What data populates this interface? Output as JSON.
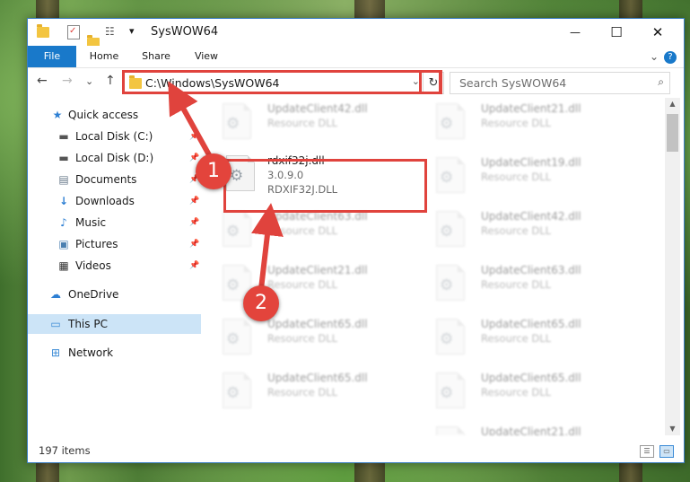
{
  "window": {
    "title": "SysWOW64",
    "controls": {
      "minimize": "—",
      "maximize": "☐",
      "close": "✕"
    }
  },
  "quick_access_toolbar": {
    "dropdown": "▾"
  },
  "ribbon": {
    "tabs": [
      "File",
      "Home",
      "Share",
      "View"
    ],
    "collapse": "⌄",
    "help": "?"
  },
  "navigation": {
    "back": "←",
    "forward": "→",
    "recent": "⌄",
    "up": "↑",
    "address": "C:\\Windows\\SysWOW64",
    "address_dropdown": "⌄",
    "refresh": "↻",
    "search_placeholder": "Search SysWOW64"
  },
  "sidebar": {
    "items": [
      {
        "label": "Quick access",
        "icon": "star-icon",
        "glyph": "★",
        "color": "#2d7fd3",
        "pinned": false
      },
      {
        "label": "Local Disk (C:)",
        "icon": "drive-icon",
        "glyph": "▬",
        "color": "#555555",
        "pinned": true
      },
      {
        "label": "Local Disk (D:)",
        "icon": "drive-icon",
        "glyph": "▬",
        "color": "#555555",
        "pinned": true
      },
      {
        "label": "Documents",
        "icon": "documents-icon",
        "glyph": "▤",
        "color": "#6b7b8c",
        "pinned": true
      },
      {
        "label": "Downloads",
        "icon": "downloads-icon",
        "glyph": "↓",
        "color": "#2d7fd3",
        "pinned": true
      },
      {
        "label": "Music",
        "icon": "music-icon",
        "glyph": "♪",
        "color": "#2d7fd3",
        "pinned": true
      },
      {
        "label": "Pictures",
        "icon": "pictures-icon",
        "glyph": "▣",
        "color": "#4a7fb0",
        "pinned": true
      },
      {
        "label": "Videos",
        "icon": "videos-icon",
        "glyph": "▦",
        "color": "#333333",
        "pinned": true
      },
      {
        "label": "OneDrive",
        "icon": "cloud-icon",
        "glyph": "☁",
        "color": "#2d7fd3",
        "pinned": false
      },
      {
        "label": "This PC",
        "icon": "computer-icon",
        "glyph": "▭",
        "color": "#3b8bd6",
        "pinned": false,
        "selected": true
      },
      {
        "label": "Network",
        "icon": "network-icon",
        "glyph": "⊞",
        "color": "#3b8bd6",
        "pinned": false
      }
    ],
    "pin_glyph": "📌"
  },
  "files": {
    "highlighted": {
      "name": "rdxif32j.dll",
      "version": "3.0.9.0",
      "internal_name": "RDXIF32J.DLL"
    },
    "left_column": [
      {
        "name": "UpdateClient42.dll",
        "type": "Resource DLL"
      },
      {
        "name": "UpdateClient63.dll",
        "type": "Resource DLL"
      },
      {
        "name": "UpdateClient21.dll",
        "type": "Resource DLL"
      },
      {
        "name": "UpdateClient65.dll",
        "type": "Resource DLL"
      },
      {
        "name": "UpdateClient65.dll",
        "type": "Resource DLL"
      }
    ],
    "right_column": [
      {
        "name": "UpdateClient21.dll",
        "type": "Resource DLL"
      },
      {
        "name": "UpdateClient19.dll",
        "type": "Resource DLL"
      },
      {
        "name": "UpdateClient42.dll",
        "type": "Resource DLL"
      },
      {
        "name": "UpdateClient63.dll",
        "type": "Resource DLL"
      },
      {
        "name": "UpdateClient65.dll",
        "type": "Resource DLL"
      },
      {
        "name": "UpdateClient65.dll",
        "type": "Resource DLL"
      },
      {
        "name": "UpdateClient21.dll",
        "type": "Resource DLL"
      }
    ]
  },
  "status_bar": {
    "item_count": "197 items"
  },
  "annotations": {
    "step1": "1",
    "step2": "2",
    "color": "#e0433d"
  }
}
